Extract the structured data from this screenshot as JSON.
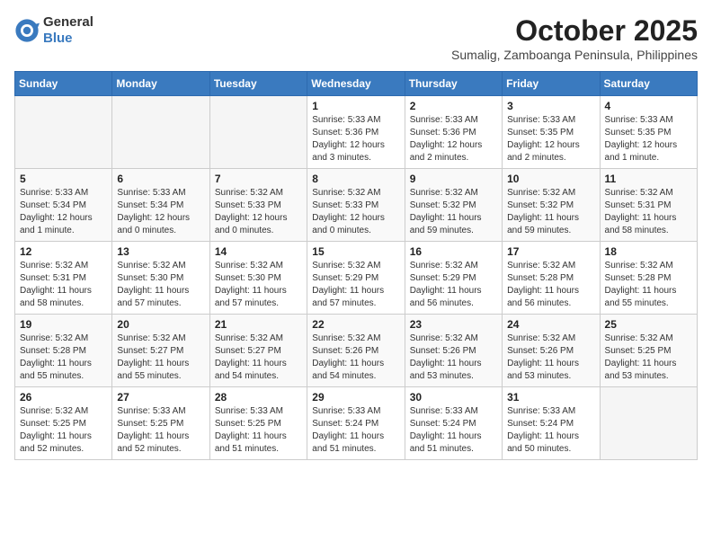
{
  "logo": {
    "general": "General",
    "blue": "Blue"
  },
  "title": "October 2025",
  "subtitle": "Sumalig, Zamboanga Peninsula, Philippines",
  "weekdays": [
    "Sunday",
    "Monday",
    "Tuesday",
    "Wednesday",
    "Thursday",
    "Friday",
    "Saturday"
  ],
  "weeks": [
    [
      {
        "day": "",
        "info": ""
      },
      {
        "day": "",
        "info": ""
      },
      {
        "day": "",
        "info": ""
      },
      {
        "day": "1",
        "info": "Sunrise: 5:33 AM\nSunset: 5:36 PM\nDaylight: 12 hours and 3 minutes."
      },
      {
        "day": "2",
        "info": "Sunrise: 5:33 AM\nSunset: 5:36 PM\nDaylight: 12 hours and 2 minutes."
      },
      {
        "day": "3",
        "info": "Sunrise: 5:33 AM\nSunset: 5:35 PM\nDaylight: 12 hours and 2 minutes."
      },
      {
        "day": "4",
        "info": "Sunrise: 5:33 AM\nSunset: 5:35 PM\nDaylight: 12 hours and 1 minute."
      }
    ],
    [
      {
        "day": "5",
        "info": "Sunrise: 5:33 AM\nSunset: 5:34 PM\nDaylight: 12 hours and 1 minute."
      },
      {
        "day": "6",
        "info": "Sunrise: 5:33 AM\nSunset: 5:34 PM\nDaylight: 12 hours and 0 minutes."
      },
      {
        "day": "7",
        "info": "Sunrise: 5:32 AM\nSunset: 5:33 PM\nDaylight: 12 hours and 0 minutes."
      },
      {
        "day": "8",
        "info": "Sunrise: 5:32 AM\nSunset: 5:33 PM\nDaylight: 12 hours and 0 minutes."
      },
      {
        "day": "9",
        "info": "Sunrise: 5:32 AM\nSunset: 5:32 PM\nDaylight: 11 hours and 59 minutes."
      },
      {
        "day": "10",
        "info": "Sunrise: 5:32 AM\nSunset: 5:32 PM\nDaylight: 11 hours and 59 minutes."
      },
      {
        "day": "11",
        "info": "Sunrise: 5:32 AM\nSunset: 5:31 PM\nDaylight: 11 hours and 58 minutes."
      }
    ],
    [
      {
        "day": "12",
        "info": "Sunrise: 5:32 AM\nSunset: 5:31 PM\nDaylight: 11 hours and 58 minutes."
      },
      {
        "day": "13",
        "info": "Sunrise: 5:32 AM\nSunset: 5:30 PM\nDaylight: 11 hours and 57 minutes."
      },
      {
        "day": "14",
        "info": "Sunrise: 5:32 AM\nSunset: 5:30 PM\nDaylight: 11 hours and 57 minutes."
      },
      {
        "day": "15",
        "info": "Sunrise: 5:32 AM\nSunset: 5:29 PM\nDaylight: 11 hours and 57 minutes."
      },
      {
        "day": "16",
        "info": "Sunrise: 5:32 AM\nSunset: 5:29 PM\nDaylight: 11 hours and 56 minutes."
      },
      {
        "day": "17",
        "info": "Sunrise: 5:32 AM\nSunset: 5:28 PM\nDaylight: 11 hours and 56 minutes."
      },
      {
        "day": "18",
        "info": "Sunrise: 5:32 AM\nSunset: 5:28 PM\nDaylight: 11 hours and 55 minutes."
      }
    ],
    [
      {
        "day": "19",
        "info": "Sunrise: 5:32 AM\nSunset: 5:28 PM\nDaylight: 11 hours and 55 minutes."
      },
      {
        "day": "20",
        "info": "Sunrise: 5:32 AM\nSunset: 5:27 PM\nDaylight: 11 hours and 55 minutes."
      },
      {
        "day": "21",
        "info": "Sunrise: 5:32 AM\nSunset: 5:27 PM\nDaylight: 11 hours and 54 minutes."
      },
      {
        "day": "22",
        "info": "Sunrise: 5:32 AM\nSunset: 5:26 PM\nDaylight: 11 hours and 54 minutes."
      },
      {
        "day": "23",
        "info": "Sunrise: 5:32 AM\nSunset: 5:26 PM\nDaylight: 11 hours and 53 minutes."
      },
      {
        "day": "24",
        "info": "Sunrise: 5:32 AM\nSunset: 5:26 PM\nDaylight: 11 hours and 53 minutes."
      },
      {
        "day": "25",
        "info": "Sunrise: 5:32 AM\nSunset: 5:25 PM\nDaylight: 11 hours and 53 minutes."
      }
    ],
    [
      {
        "day": "26",
        "info": "Sunrise: 5:32 AM\nSunset: 5:25 PM\nDaylight: 11 hours and 52 minutes."
      },
      {
        "day": "27",
        "info": "Sunrise: 5:33 AM\nSunset: 5:25 PM\nDaylight: 11 hours and 52 minutes."
      },
      {
        "day": "28",
        "info": "Sunrise: 5:33 AM\nSunset: 5:25 PM\nDaylight: 11 hours and 51 minutes."
      },
      {
        "day": "29",
        "info": "Sunrise: 5:33 AM\nSunset: 5:24 PM\nDaylight: 11 hours and 51 minutes."
      },
      {
        "day": "30",
        "info": "Sunrise: 5:33 AM\nSunset: 5:24 PM\nDaylight: 11 hours and 51 minutes."
      },
      {
        "day": "31",
        "info": "Sunrise: 5:33 AM\nSunset: 5:24 PM\nDaylight: 11 hours and 50 minutes."
      },
      {
        "day": "",
        "info": ""
      }
    ]
  ]
}
